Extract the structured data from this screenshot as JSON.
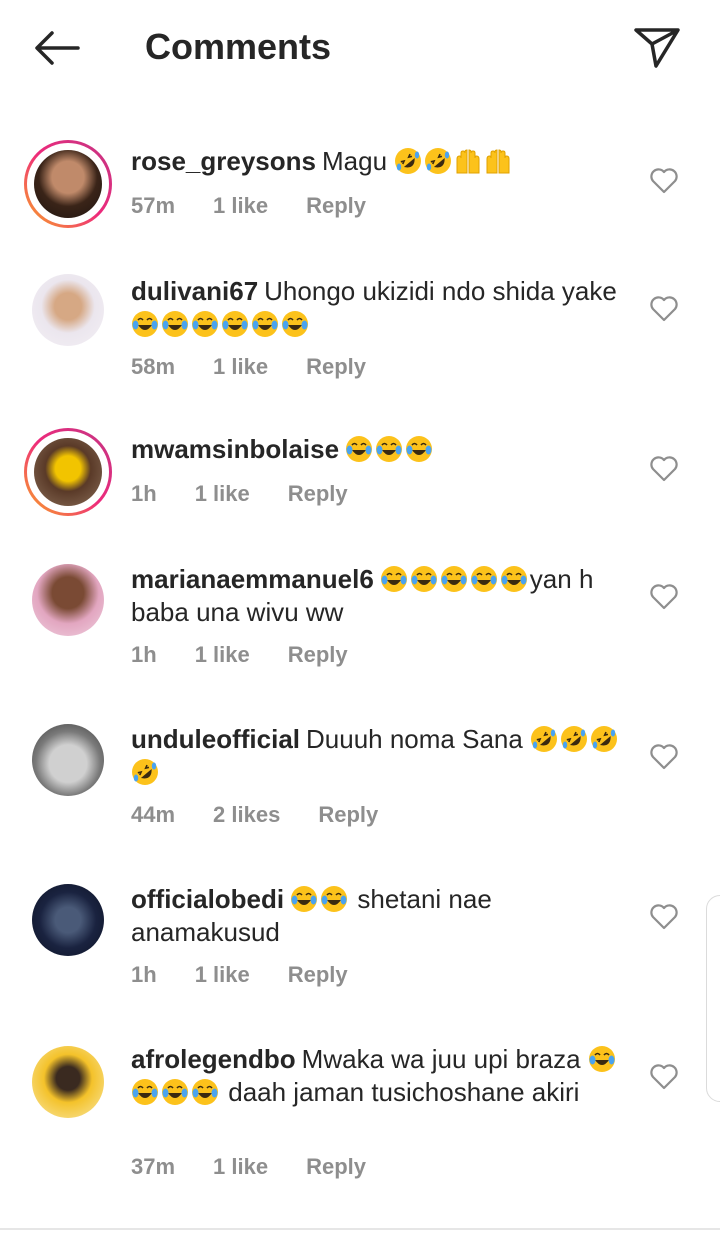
{
  "header": {
    "title": "Comments"
  },
  "comments": [
    {
      "username": "rose_greysons",
      "text_before": "Magu",
      "emojis1": [
        "rofl",
        "rofl",
        "hands",
        "hands"
      ],
      "time": "57m",
      "likes": "1 like",
      "reply": "Reply"
    },
    {
      "username": "dulivani67",
      "text_before": "Uhongo ukizidi ndo shida yake",
      "emojis1": [
        "joy",
        "joy",
        "joy",
        "joy",
        "joy",
        "joy"
      ],
      "time": "58m",
      "likes": "1 like",
      "reply": "Reply"
    },
    {
      "username": "mwamsinbolaise",
      "emojis1": [
        "joy",
        "joy",
        "joy"
      ],
      "time": "1h",
      "likes": "1 like",
      "reply": "Reply"
    },
    {
      "username": "marianaemmanuel6",
      "emojis1": [
        "joy",
        "joy",
        "joy",
        "joy",
        "joy"
      ],
      "text_after": "yan h baba una wivu ww",
      "time": "1h",
      "likes": "1 like",
      "reply": "Reply"
    },
    {
      "username": "unduleofficial",
      "text_before": "Duuuh noma Sana",
      "emojis1": [
        "rofl",
        "rofl",
        "rofl",
        "rofl"
      ],
      "time": "44m",
      "likes": "2 likes",
      "reply": "Reply"
    },
    {
      "username": "officialobedi",
      "emojis1": [
        "joy",
        "joy"
      ],
      "text_after": "shetani nae anamakusud",
      "time": "1h",
      "likes": "1 like",
      "reply": "Reply"
    },
    {
      "username": "afrolegendbo",
      "text_before": "Mwaka  wa juu upi braza",
      "emojis1": [
        "joy",
        "joy",
        "joy",
        "joy"
      ],
      "text_after": "daah jaman tusichoshane akiri",
      "time": "37m",
      "likes": "1 like",
      "reply": "Reply"
    }
  ]
}
